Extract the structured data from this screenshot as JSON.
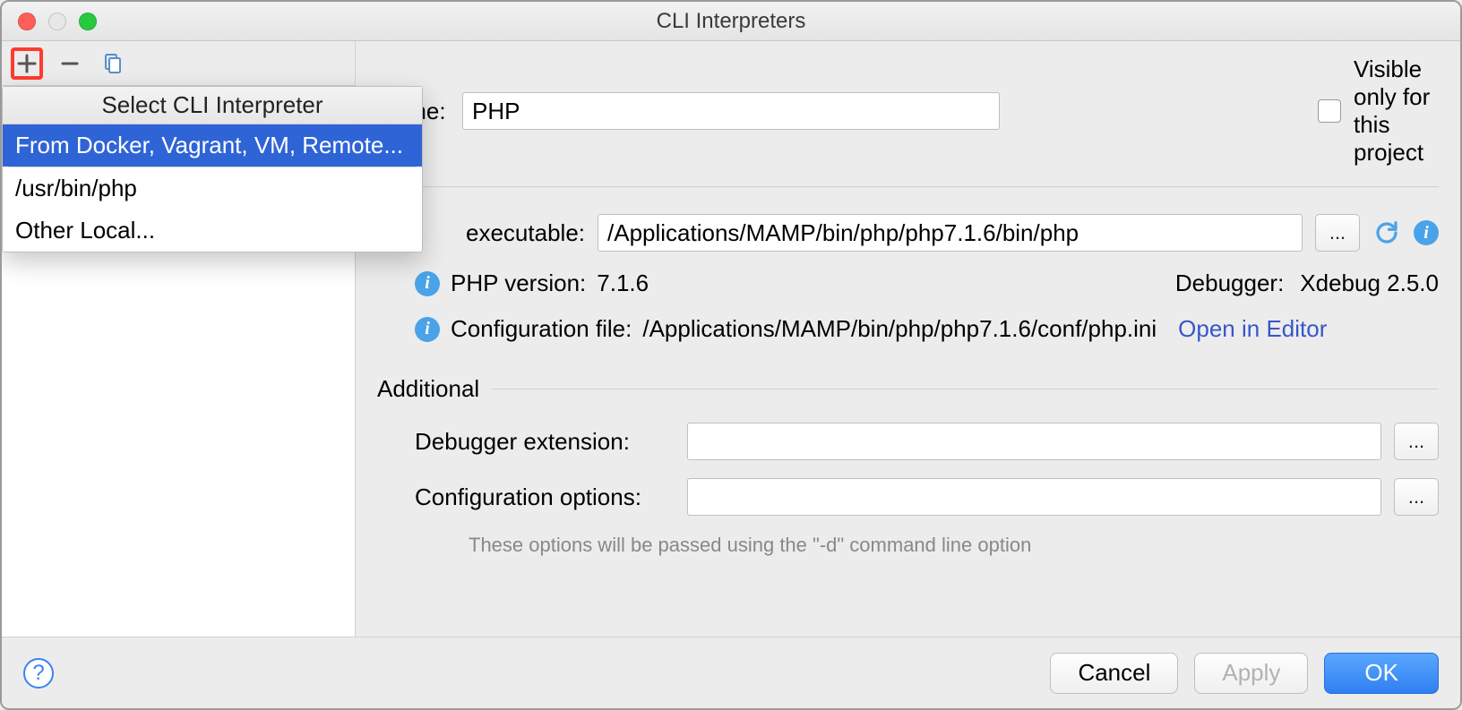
{
  "window": {
    "title": "CLI Interpreters"
  },
  "toolbar": {
    "add": "+",
    "remove": "−"
  },
  "popup": {
    "title": "Select CLI Interpreter",
    "items": [
      "From Docker, Vagrant, VM, Remote...",
      "/usr/bin/php",
      "Other Local..."
    ],
    "selectedIndex": 0
  },
  "form": {
    "name_label": "Name:",
    "name_value": "PHP",
    "visible_label": "Visible only for this project",
    "visible_checked": false,
    "general": {
      "exec_label": "executable:",
      "exec_value": "/Applications/MAMP/bin/php/php7.1.6/bin/php",
      "browse": "...",
      "php_version_label": "PHP version:",
      "php_version_value": "7.1.6",
      "debugger_label": "Debugger:",
      "debugger_value": "Xdebug 2.5.0",
      "config_label": "Configuration file:",
      "config_value": "/Applications/MAMP/bin/php/php7.1.6/conf/php.ini",
      "open_in_editor": "Open in Editor"
    },
    "additional": {
      "title": "Additional",
      "ext_label": "Debugger extension:",
      "ext_value": "",
      "opts_label": "Configuration options:",
      "opts_value": "",
      "hint": "These options will be passed using the \"-d\" command line option",
      "browse": "..."
    }
  },
  "footer": {
    "cancel": "Cancel",
    "apply": "Apply",
    "ok": "OK"
  }
}
